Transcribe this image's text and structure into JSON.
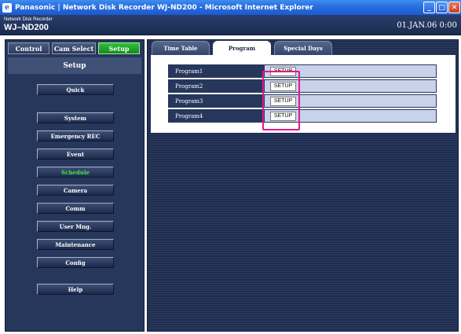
{
  "window": {
    "icon": "ie-icon",
    "title": "Panasonic | Network Disk Recorder WJ-ND200 - Microsoft Internet Explorer",
    "buttons": {
      "minimize": "_",
      "maximize": "□",
      "close": "✕"
    }
  },
  "header": {
    "brand": "Network Disk Recorder",
    "model": "WJ–ND200",
    "datetime": "01.JAN.06  0:00"
  },
  "mode_tabs": [
    {
      "label": "Control",
      "active": false
    },
    {
      "label": "Cam Select",
      "active": false
    },
    {
      "label": "Setup",
      "active": true
    }
  ],
  "sidebar": {
    "title": "Setup",
    "items": [
      {
        "label": "Quick"
      },
      {
        "label": "System"
      },
      {
        "label": "Emergency REC"
      },
      {
        "label": "Event"
      },
      {
        "label": "Schedule",
        "active": true
      },
      {
        "label": "Camera"
      },
      {
        "label": "Comm"
      },
      {
        "label": "User Mng."
      },
      {
        "label": "Maintenance"
      },
      {
        "label": "Config"
      },
      {
        "label": "Help"
      }
    ]
  },
  "sub_tabs": [
    {
      "label": "Time Table",
      "active": false
    },
    {
      "label": "Program",
      "active": true
    },
    {
      "label": "Special Days",
      "active": false
    }
  ],
  "programs": [
    {
      "label": "Program1",
      "button": "SETUP"
    },
    {
      "label": "Program2",
      "button": "SETUP"
    },
    {
      "label": "Program3",
      "button": "SETUP"
    },
    {
      "label": "Program4",
      "button": "SETUP"
    }
  ],
  "colors": {
    "accent_green": "#1a9e25",
    "highlight": "#e5168d",
    "panel": "#27375c"
  }
}
